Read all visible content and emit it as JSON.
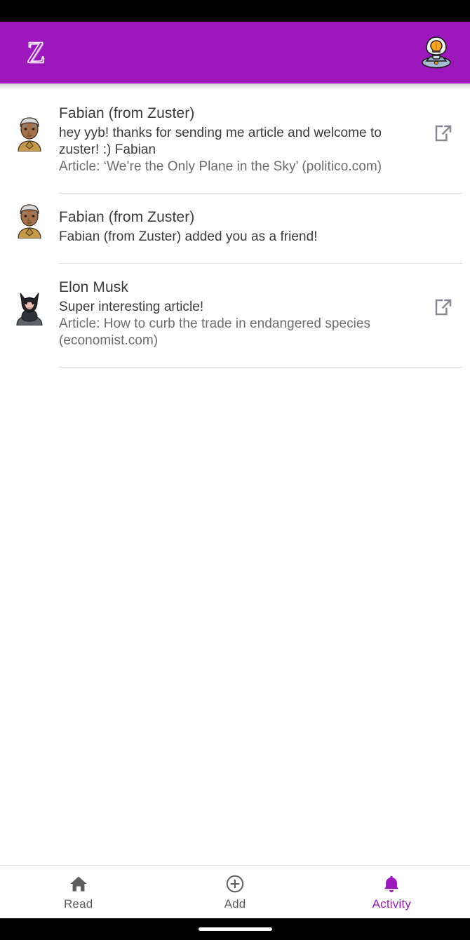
{
  "app": {
    "brand_logo_text": "Z",
    "header_icon": "lightbulb-robot-icon",
    "accent_color": "#9c18bb",
    "header_background": "#9c18bb"
  },
  "notifications": [
    {
      "avatar_icon": "older-man-avatar",
      "sender": "Fabian (from Zuster)",
      "message": "hey yyb! thanks for sending me article and welcome to zuster! :) Fabian",
      "article": "Article: ‘We’re the Only Plane in the Sky’ (politico.com)",
      "has_open_action": true,
      "open_action_icon": "external-link-icon"
    },
    {
      "avatar_icon": "older-man-avatar",
      "sender": "Fabian (from Zuster)",
      "message": "Fabian (from Zuster) added you as a friend!",
      "article": "",
      "has_open_action": false,
      "open_action_icon": ""
    },
    {
      "avatar_icon": "batman-superhero-avatar",
      "sender": "Elon Musk",
      "message": "Super interesting article!",
      "article": "Article: How to curb the trade in endangered species (economist.com)",
      "has_open_action": true,
      "open_action_icon": "external-link-icon"
    }
  ],
  "bottom_nav": {
    "items": [
      {
        "label": "Read",
        "icon": "home-icon",
        "active": false
      },
      {
        "label": "Add",
        "icon": "plus-circle-icon",
        "active": false
      },
      {
        "label": "Activity",
        "icon": "bell-icon",
        "active": true
      }
    ],
    "active_color": "#9c18bb",
    "inactive_color": "#5e5e5e"
  }
}
